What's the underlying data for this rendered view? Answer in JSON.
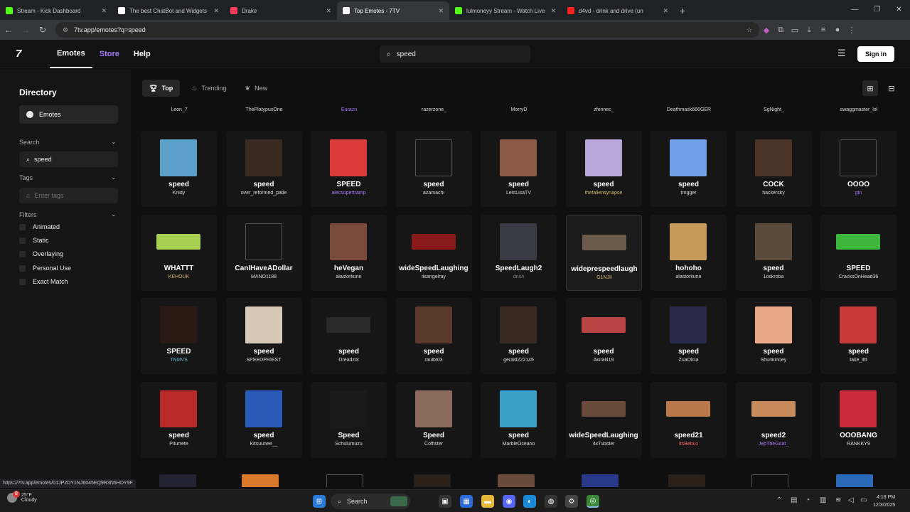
{
  "browser": {
    "tabs": [
      {
        "title": "Stream - Kick Dashboard",
        "icon": "kick-icon",
        "color": "#53fc18",
        "active": false
      },
      {
        "title": "The best ChatBot and Widgets",
        "icon": "botrix-icon",
        "color": "#ffffff",
        "active": false
      },
      {
        "title": "Drake",
        "icon": "music-icon",
        "color": "#ff3b5c",
        "active": false
      },
      {
        "title": "Top Emotes - 7TV",
        "icon": "7tv-icon",
        "color": "#ffffff",
        "active": true
      },
      {
        "title": "lulmoneyy Stream - Watch Live",
        "icon": "kick-icon",
        "color": "#53fc18",
        "active": false
      },
      {
        "title": "d4vd - drink and drive (un",
        "icon": "youtube-icon",
        "color": "#ff2020",
        "active": false
      }
    ],
    "url": "7tv.app/emotes?q=speed",
    "status_url": "https://7tv.app/emotes/01JP2DY1NJ6045EQ9R3N5HDY9F"
  },
  "site": {
    "logo": "7",
    "nav": [
      "Emotes",
      "Store",
      "Help"
    ],
    "search_value": "speed",
    "signin_label": "Sign in"
  },
  "sidebar": {
    "title": "Directory",
    "emotes_label": "Emotes",
    "search_label": "Search",
    "search_value": "speed",
    "tags_label": "Tags",
    "tags_placeholder": "Enter tags",
    "filters_label": "Filters",
    "filters": [
      "Animated",
      "Static",
      "Overlaying",
      "Personal Use",
      "Exact Match"
    ]
  },
  "subtabs": [
    "Top",
    "Trending",
    "New"
  ],
  "top_row_authors": [
    "Leon_7",
    "ThePlatypusOne",
    "Eurazn",
    "razerzone_",
    "MorryD",
    "zfennec_",
    "Deathmask666GER",
    "SgNight_",
    "swaggmaster_lol"
  ],
  "emotes": [
    {
      "name": "speed",
      "author": "Kriidy",
      "thumb": "#5aa0c8",
      "author_color": "#dddddd"
    },
    {
      "name": "speed",
      "author": "over_reformed_patle",
      "thumb": "#3a2a22",
      "author_color": "#dddddd"
    },
    {
      "name": "SPEED",
      "author": "alecsupertramp",
      "thumb": "#d93a3a",
      "author_color": "#a77bff"
    },
    {
      "name": "speed",
      "author": "azamachi",
      "thumb": "broken",
      "author_color": "#dddddd"
    },
    {
      "name": "speed",
      "author": "LetsLisaTV",
      "thumb": "#8a5a44",
      "author_color": "#dddddd"
    },
    {
      "name": "speed",
      "author": "thefallensynapse",
      "thumb": "#b9a6d8",
      "author_color": "#d8b870"
    },
    {
      "name": "speed",
      "author": "trrigger",
      "thumb": "#6fa0e8",
      "author_color": "#dddddd"
    },
    {
      "name": "COCK",
      "author": "hackersky",
      "thumb": "#4a3428",
      "author_color": "#dddddd"
    },
    {
      "name": "OOOO",
      "author": "gtn",
      "thumb": "broken",
      "author_color": "#a77bff"
    },
    {
      "name": "WHATTT",
      "author": "KEHOUK",
      "thumb": "#a8d050",
      "author_color": "#d8b870",
      "wide": true
    },
    {
      "name": "CanIHaveADollar",
      "author": "MANO1188",
      "thumb": "broken",
      "author_color": "#dddddd"
    },
    {
      "name": "heVegan",
      "author": "alastorkunn",
      "thumb": "#7a4a3a",
      "author_color": "#dddddd"
    },
    {
      "name": "wideSpeedLaughing",
      "author": "itsangelray",
      "thumb": "#8a1a1a",
      "author_color": "#dddddd",
      "wide": true
    },
    {
      "name": "SpeedLaugh2",
      "author": "dnsh",
      "thumb": "#3a3a44",
      "author_color": "#888888"
    },
    {
      "name": "wideprespeedlaugh",
      "author": "G1NJII",
      "thumb": "#6a5a4a",
      "author_color": "#d8b870",
      "wide": true,
      "highlight": true
    },
    {
      "name": "hohoho",
      "author": "alastorkunn",
      "thumb": "#c89a5a",
      "author_color": "#dddddd"
    },
    {
      "name": "speed",
      "author": "1oskroba",
      "thumb": "#5a4a3a",
      "author_color": "#dddddd"
    },
    {
      "name": "SPEED",
      "author": "CracksOnHead36",
      "thumb": "#3db83d",
      "author_color": "#dddddd",
      "wide": true
    },
    {
      "name": "SPEED",
      "author": "TNMVS",
      "thumb": "#2a1a14",
      "author_color": "#70b8d8"
    },
    {
      "name": "speed",
      "author": "SPEEDPRIEST",
      "thumb": "#d8c8b8",
      "author_color": "#dddddd"
    },
    {
      "name": "speed",
      "author": "Dreadzot",
      "thumb": "#2a2a2a",
      "author_color": "#dddddd",
      "wide": true
    },
    {
      "name": "speed",
      "author": "raulbt03",
      "thumb": "#5a3a2a",
      "author_color": "#dddddd"
    },
    {
      "name": "speed",
      "author": "gerald222145",
      "thumb": "#3a2a24",
      "author_color": "#dddddd"
    },
    {
      "name": "speed",
      "author": "AkiraN19",
      "thumb": "#b84444",
      "author_color": "#dddddd",
      "wide": true
    },
    {
      "name": "speed",
      "author": "ZuaOlcia",
      "thumb": "#2a2a4a",
      "author_color": "#dddddd"
    },
    {
      "name": "speed",
      "author": "Shurikinney",
      "thumb": "#e8a888",
      "author_color": "#dddddd"
    },
    {
      "name": "speed",
      "author": "take_ittt",
      "thumb": "#c83a3a",
      "author_color": "#dddddd"
    },
    {
      "name": "speed",
      "author": "Piturrete",
      "thumb": "#b82a2a",
      "author_color": "#dddddd"
    },
    {
      "name": "speed",
      "author": "Kitsuunee__",
      "thumb": "#2a5ab8",
      "author_color": "#dddddd"
    },
    {
      "name": "Speed",
      "author": "Schulumuzu",
      "thumb": "#1a1a1a",
      "author_color": "#dddddd"
    },
    {
      "name": "Speed",
      "author": "Coffister",
      "thumb": "#8a6a5a",
      "author_color": "#dddddd"
    },
    {
      "name": "speed",
      "author": "MarbleOceano",
      "thumb": "#3aa0c8",
      "author_color": "#dddddd"
    },
    {
      "name": "wideSpeedLaughing",
      "author": "4xTubster",
      "thumb": "#6a4a3a",
      "author_color": "#dddddd",
      "wide": true
    },
    {
      "name": "speed21",
      "author": "ItsBebux",
      "thumb": "#b8784a",
      "author_color": "#ff6060",
      "wide": true
    },
    {
      "name": "speed2",
      "author": "JepTheGoat_",
      "thumb": "#c88a5a",
      "author_color": "#a77bff",
      "wide": true
    },
    {
      "name": "OOOBANG",
      "author": "RANKKY9",
      "thumb": "#c82a3a",
      "author_color": "#dddddd"
    }
  ],
  "taskbar": {
    "temp": "25°F",
    "condition": "Cloudy",
    "weather_badge": "8",
    "search_label": "Search",
    "time": "4:18 PM",
    "date": "12/3/2025"
  }
}
